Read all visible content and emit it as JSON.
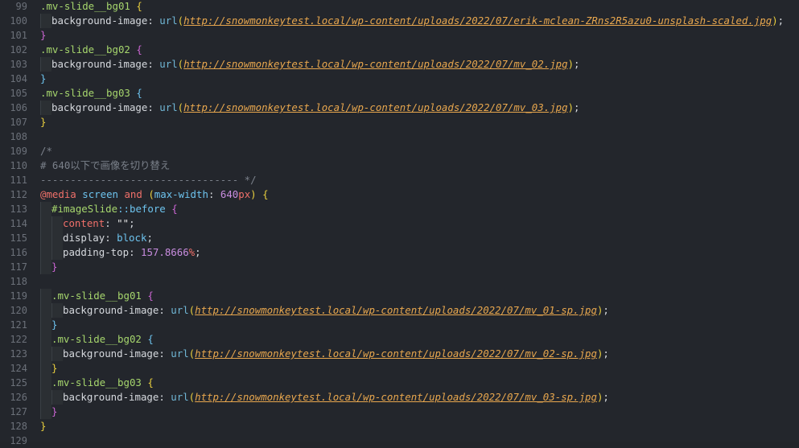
{
  "editor": {
    "line_numbers": [
      "99",
      "100",
      "101",
      "102",
      "103",
      "104",
      "105",
      "106",
      "107",
      "108",
      "109",
      "110",
      "111",
      "112",
      "113",
      "114",
      "115",
      "116",
      "117",
      "118",
      "119",
      "120",
      "121",
      "122",
      "123",
      "124",
      "125",
      "126",
      "127",
      "128",
      "129"
    ],
    "lines": {
      "l99_sel": ".mv-slide__bg01",
      "l99_brace": "{",
      "l100_prop": "background-image",
      "l100_colon": ": ",
      "l100_fn": "url",
      "l100_open": "(",
      "l100_url": "http://snowmonkeytest.local/wp-content/uploads/2022/07/erik-mclean-ZRns2R5azu0-unsplash-scaled.jpg",
      "l100_close": ")",
      "l100_semi": ";",
      "l101_brace": "}",
      "l102_sel": ".mv-slide__bg02",
      "l102_brace": "{",
      "l103_prop": "background-image",
      "l103_colon": ": ",
      "l103_fn": "url",
      "l103_open": "(",
      "l103_url": "http://snowmonkeytest.local/wp-content/uploads/2022/07/mv_02.jpg",
      "l103_close": ")",
      "l103_semi": ";",
      "l104_brace": "}",
      "l105_sel": ".mv-slide__bg03",
      "l105_brace": "{",
      "l106_prop": "background-image",
      "l106_colon": ": ",
      "l106_fn": "url",
      "l106_open": "(",
      "l106_url": "http://snowmonkeytest.local/wp-content/uploads/2022/07/mv_03.jpg",
      "l106_close": ")",
      "l106_semi": ";",
      "l107_brace": "}",
      "l109_comment": "/*",
      "l110_comment": "# 640以下で画像を切り替え",
      "l111_comment": "--------------------------------- */",
      "l112_at": "@media",
      "l112_screen": "screen",
      "l112_and": "and",
      "l112_open": "(",
      "l112_feature": "max-width",
      "l112_colon": ": ",
      "l112_num": "640",
      "l112_unit": "px",
      "l112_close": ")",
      "l112_brace": "{",
      "l113_id": "#imageSlide",
      "l113_pseudo": "::before",
      "l113_brace": "{",
      "l114_prop": "content",
      "l114_colon": ": ",
      "l114_str": "\"\"",
      "l114_semi": ";",
      "l115_prop": "display",
      "l115_colon": ": ",
      "l115_val": "block",
      "l115_semi": ";",
      "l116_prop": "padding-top",
      "l116_colon": ": ",
      "l116_num": "157.8666",
      "l116_unit": "%",
      "l116_semi": ";",
      "l117_brace": "}",
      "l119_sel": ".mv-slide__bg01",
      "l119_brace": "{",
      "l120_prop": "background-image",
      "l120_colon": ": ",
      "l120_fn": "url",
      "l120_open": "(",
      "l120_url": "http://snowmonkeytest.local/wp-content/uploads/2022/07/mv_01-sp.jpg",
      "l120_close": ")",
      "l120_semi": ";",
      "l121_brace": "}",
      "l122_sel": ".mv-slide__bg02",
      "l122_brace": "{",
      "l123_prop": "background-image",
      "l123_colon": ": ",
      "l123_fn": "url",
      "l123_open": "(",
      "l123_url": "http://snowmonkeytest.local/wp-content/uploads/2022/07/mv_02-sp.jpg",
      "l123_close": ")",
      "l123_semi": ";",
      "l124_brace": "}",
      "l125_sel": ".mv-slide__bg03",
      "l125_brace": "{",
      "l126_prop": "background-image",
      "l126_colon": ": ",
      "l126_fn": "url",
      "l126_open": "(",
      "l126_url": "http://snowmonkeytest.local/wp-content/uploads/2022/07/mv_03-sp.jpg",
      "l126_close": ")",
      "l126_semi": ";",
      "l127_brace": "}",
      "l128_brace": "}"
    }
  }
}
